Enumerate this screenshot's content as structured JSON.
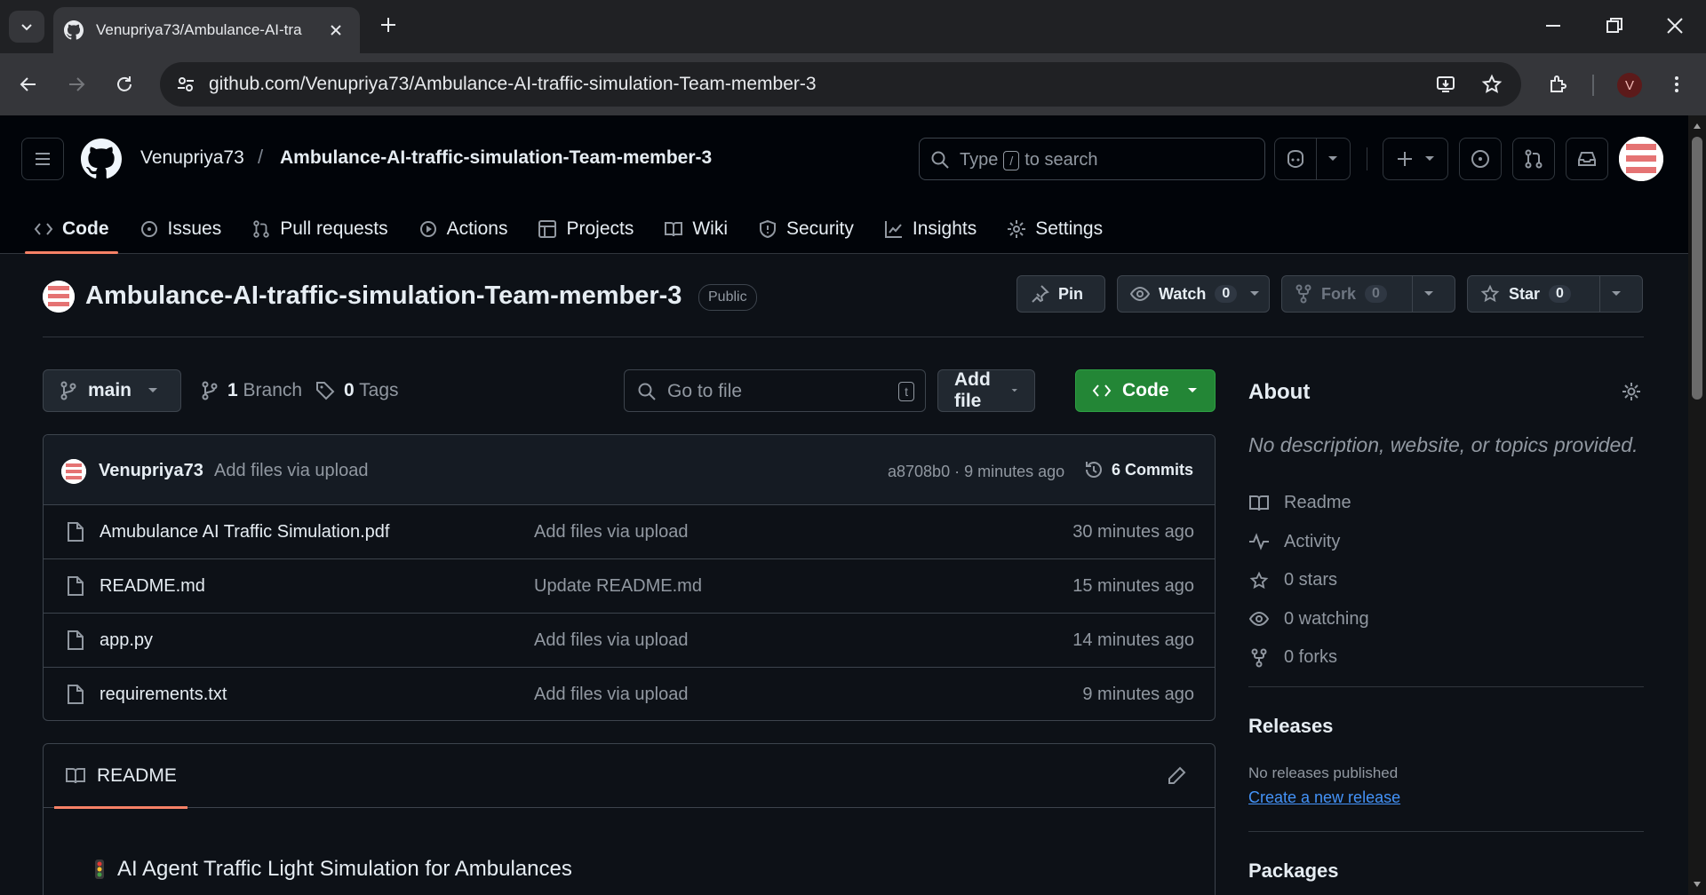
{
  "browser": {
    "tab_title": "Venupriya73/Ambulance-AI-tra",
    "url": "github.com/Venupriya73/Ambulance-AI-traffic-simulation-Team-member-3",
    "profile_initial": "V"
  },
  "header": {
    "owner": "Venupriya73",
    "separator": "/",
    "repo": "Ambulance-AI-traffic-simulation-Team-member-3",
    "search_prefix": "Type",
    "search_key": "/",
    "search_suffix": "to search"
  },
  "nav": {
    "code": "Code",
    "issues": "Issues",
    "pulls": "Pull requests",
    "actions": "Actions",
    "projects": "Projects",
    "wiki": "Wiki",
    "security": "Security",
    "insights": "Insights",
    "settings": "Settings"
  },
  "repo": {
    "name": "Ambulance-AI-traffic-simulation-Team-member-3",
    "visibility": "Public",
    "pin_label": "Pin",
    "watch_label": "Watch",
    "watch_count": "0",
    "fork_label": "Fork",
    "fork_count": "0",
    "star_label": "Star",
    "star_count": "0"
  },
  "toolbar": {
    "branch": "main",
    "branch_count": "1",
    "branch_word": "Branch",
    "tag_count": "0",
    "tag_word": "Tags",
    "goto_placeholder": "Go to file",
    "goto_key": "t",
    "add_file": "Add file",
    "code_btn": "Code"
  },
  "commit": {
    "author": "Venupriya73",
    "message": "Add files via upload",
    "hash_time": "a8708b0 · 9 minutes ago",
    "commits": "6 Commits"
  },
  "files": [
    {
      "name": "Amubulance AI Traffic Simulation.pdf",
      "message": "Add files via upload",
      "time": "30 minutes ago"
    },
    {
      "name": "README.md",
      "message": "Update README.md",
      "time": "15 minutes ago"
    },
    {
      "name": "app.py",
      "message": "Add files via upload",
      "time": "14 minutes ago"
    },
    {
      "name": "requirements.txt",
      "message": "Add files via upload",
      "time": "9 minutes ago"
    }
  ],
  "readme": {
    "tab": "README",
    "heading": "AI Agent Traffic Light Simulation for Ambulances"
  },
  "about": {
    "title": "About",
    "description": "No description, website, or topics provided.",
    "readme": "Readme",
    "activity": "Activity",
    "stars": "0 stars",
    "watching": "0 watching",
    "forks": "0 forks"
  },
  "releases": {
    "title": "Releases",
    "none": "No releases published",
    "create": "Create a new release"
  },
  "packages": {
    "title": "Packages"
  },
  "colors": {
    "accent_green": "#238636",
    "nav_underline": "#f78166",
    "link_blue": "#4493f8",
    "background": "#0d1117"
  }
}
